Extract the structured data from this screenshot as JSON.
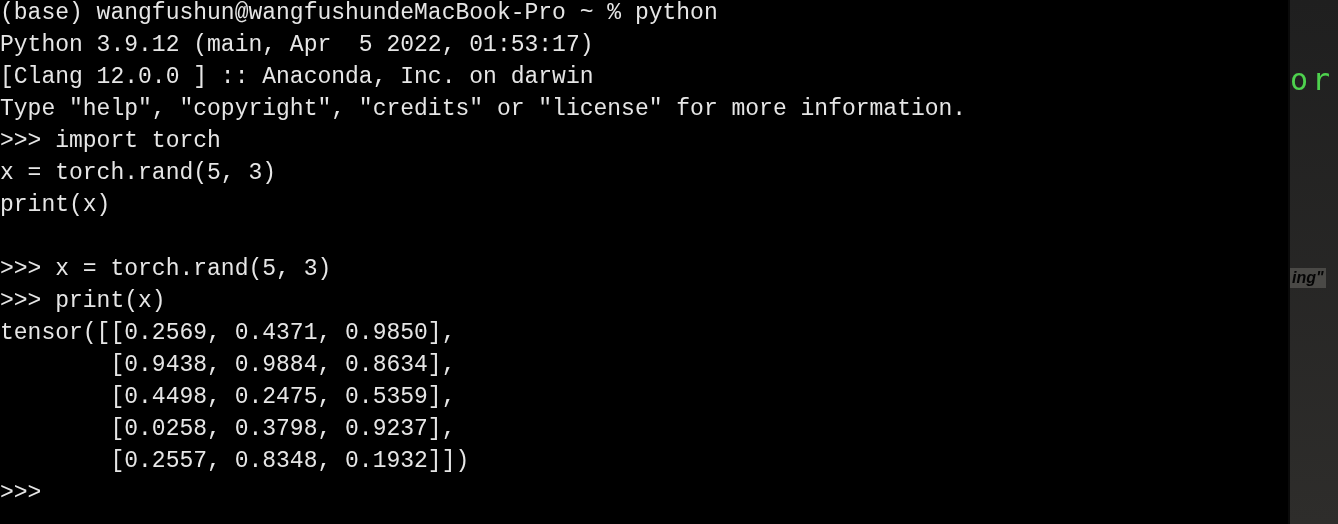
{
  "terminal": {
    "blocks": [
      {
        "lines": [
          "(base) wangfushun@wangfushundeMacBook-Pro ~ % python",
          "Python 3.9.12 (main, Apr  5 2022, 01:53:17)",
          "[Clang 12.0.0 ] :: Anaconda, Inc. on darwin",
          "Type \"help\", \"copyright\", \"credits\" or \"license\" for more information.",
          ">>> import torch",
          "x = torch.rand(5, 3)",
          "print(x)"
        ]
      },
      {
        "lines": [
          ">>> x = torch.rand(5, 3)",
          ">>> print(x)",
          "tensor([[0.2569, 0.4371, 0.9850],",
          "        [0.9438, 0.9884, 0.8634],",
          "        [0.4498, 0.2475, 0.5359],",
          "        [0.0258, 0.3798, 0.9237],",
          "        [0.2557, 0.8348, 0.1932]])",
          ">>>"
        ]
      }
    ]
  },
  "background_window": {
    "texts": [
      {
        "text": "or",
        "kind": "code"
      },
      {
        "text": "ing\"",
        "kind": "faded"
      }
    ]
  }
}
